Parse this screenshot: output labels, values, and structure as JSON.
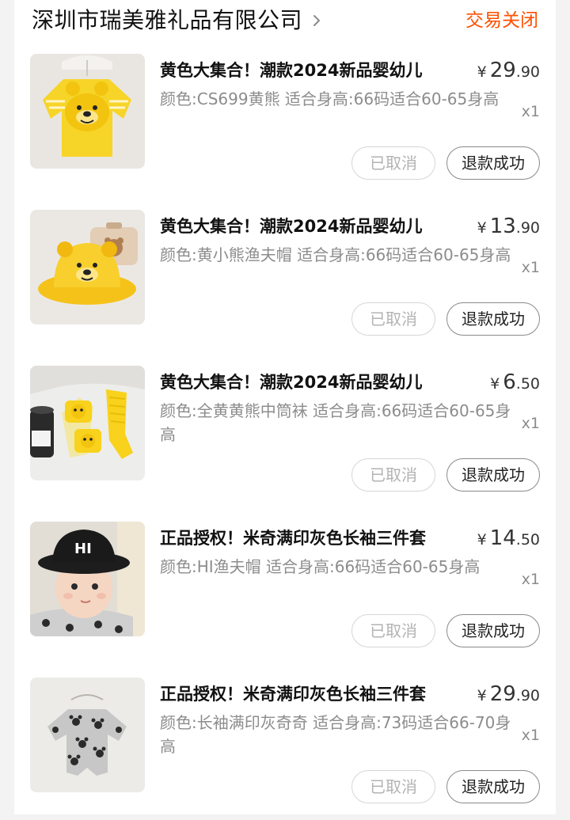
{
  "order": {
    "shop_name": "深圳市瑞美雅礼品有限公司",
    "status": "交易关闭"
  },
  "colors": {
    "status": "#ff5000",
    "text": "#111111",
    "muted": "#8c8c8c"
  },
  "items": [
    {
      "title": "黄色大集合！潮款2024新品婴幼儿",
      "price_symbol": "¥",
      "price_int": "29",
      "price_dec": ".90",
      "spec": "颜色:CS699黄熊 适合身高:66码适合60-65身高",
      "qty": "x1",
      "cancel_label": "已取消",
      "refund_label": "退款成功",
      "image": "yellow-bear-romper-image"
    },
    {
      "title": "黄色大集合！潮款2024新品婴幼儿",
      "price_symbol": "¥",
      "price_int": "13",
      "price_dec": ".90",
      "spec": "颜色:黄小熊渔夫帽 适合身高:66码适合60-65身高",
      "qty": "x1",
      "cancel_label": "已取消",
      "refund_label": "退款成功",
      "image": "yellow-bear-bucket-hat-image"
    },
    {
      "title": "黄色大集合！潮款2024新品婴幼儿",
      "price_symbol": "¥",
      "price_int": "6",
      "price_dec": ".50",
      "spec": "颜色:全黄黄熊中筒袜 适合身高:66码适合60-65身高",
      "qty": "x1",
      "cancel_label": "已取消",
      "refund_label": "退款成功",
      "image": "yellow-bear-socks-image"
    },
    {
      "title": "正品授权！米奇满印灰色长袖三件套",
      "price_symbol": "¥",
      "price_int": "14",
      "price_dec": ".50",
      "spec": "颜色:HI渔夫帽 适合身高:66码适合60-65身高",
      "qty": "x1",
      "cancel_label": "已取消",
      "refund_label": "退款成功",
      "image": "baby-black-bucket-hat-image"
    },
    {
      "title": "正品授权！米奇满印灰色长袖三件套",
      "price_symbol": "¥",
      "price_int": "29",
      "price_dec": ".90",
      "spec": "颜色:长袖满印灰奇奇 适合身高:73码适合66-70身高",
      "qty": "x1",
      "cancel_label": "已取消",
      "refund_label": "退款成功",
      "image": "grey-mickey-romper-image"
    }
  ]
}
